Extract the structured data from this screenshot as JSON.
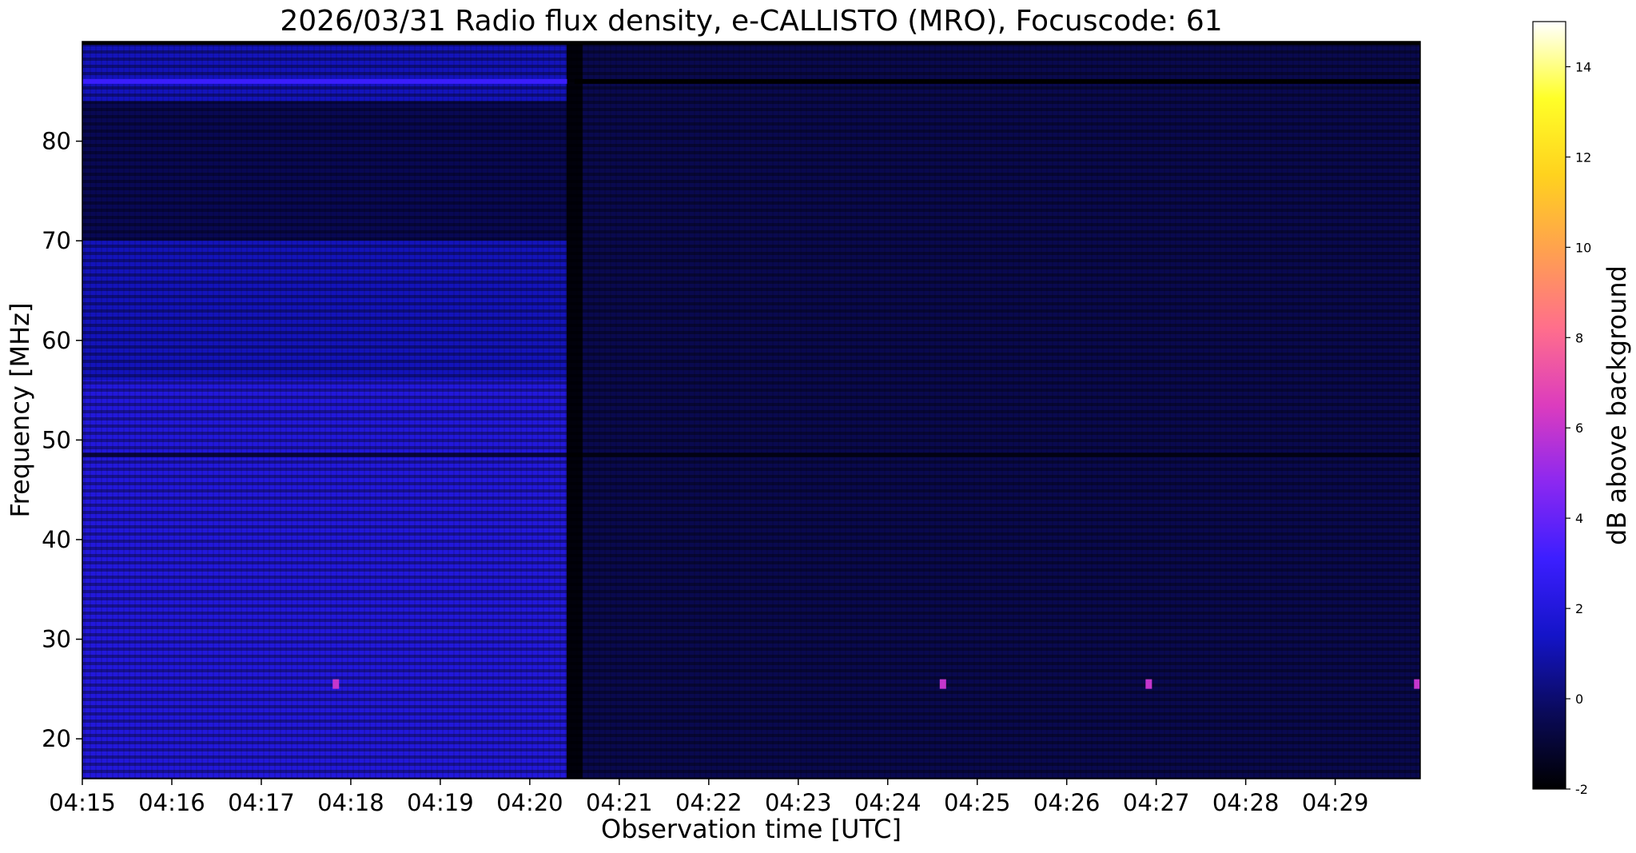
{
  "chart_data": {
    "type": "heatmap",
    "title": "2026/03/31  Radio flux density, e-CALLISTO (MRO), Focuscode: 61",
    "xlabel": "Observation time [UTC]",
    "ylabel": "Frequency [MHz]",
    "x_ticks": [
      "04:15",
      "04:16",
      "04:17",
      "04:18",
      "04:19",
      "04:20",
      "04:21",
      "04:22",
      "04:23",
      "04:24",
      "04:25",
      "04:26",
      "04:27",
      "04:28",
      "04:29"
    ],
    "x_range_minutes": [
      0,
      14.95
    ],
    "y_ticks": [
      20,
      30,
      40,
      50,
      60,
      70,
      80
    ],
    "ylim": [
      16,
      90
    ],
    "colorbar": {
      "label": "dB above background",
      "ticks": [
        -2,
        0,
        2,
        4,
        6,
        8,
        10,
        12,
        14
      ],
      "range": [
        -2,
        15
      ],
      "colormap": [
        "#000000",
        "#0a0a5a",
        "#1414c8",
        "#3c1eff",
        "#8c28f0",
        "#dc3cbe",
        "#ff6e8c",
        "#ffa050",
        "#ffd21e",
        "#ffff28",
        "#ffffff"
      ]
    },
    "features": {
      "bright_region": {
        "time_start": "04:15",
        "time_end": "04:20:25",
        "freq_range_mhz": [
          16,
          56
        ],
        "level_db": 2
      },
      "dark_region": {
        "time_start": "04:20:35",
        "time_end": "04:30",
        "level_db": -0.5
      },
      "dark_vertical_line_time": "04:20:30",
      "horizontal_band_mhz": 48.5,
      "interference_bursts": [
        {
          "time": "04:17:50",
          "freq_mhz": 25.5,
          "level_db": 6
        },
        {
          "time": "04:24:37",
          "freq_mhz": 25.5,
          "level_db": 6
        },
        {
          "time": "04:26:55",
          "freq_mhz": 25.5,
          "level_db": 6
        },
        {
          "time": "04:29:55",
          "freq_mhz": 25.5,
          "level_db": 6
        }
      ]
    }
  }
}
